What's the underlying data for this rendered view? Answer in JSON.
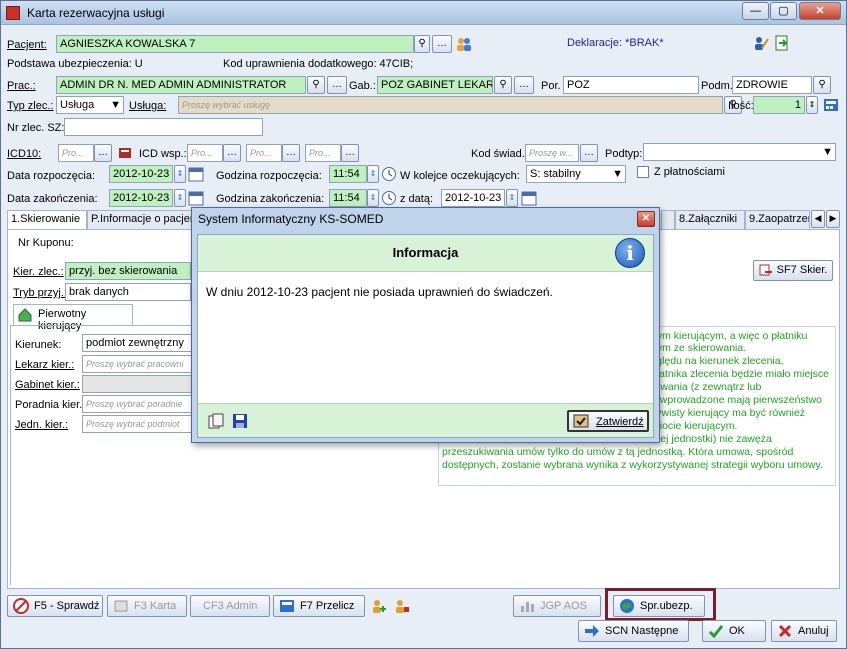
{
  "window": {
    "title": "Karta rezerwacyjna usługi"
  },
  "patient": {
    "label": "Pacjent:",
    "value": "AGNIESZKA KOWALSKA 7",
    "declarations": "Deklaracje: *BRAK*",
    "insurance": "Podstawa ubezpieczenia: U",
    "extra_code": "Kod uprawnienia dodatkowego: 47CIB;"
  },
  "staff": {
    "label": "Prac.:",
    "value": "ADMIN DR N. MED ADMIN ADMINISTRATOR",
    "gab_label": "Gab.:",
    "gab_value": "POZ GABINET LEKARZ",
    "por_label": "Por.",
    "por_value": "POZ",
    "podm_label": "Podm.",
    "podm_value": "ZDROWIE"
  },
  "order": {
    "type_label": "Typ zlec.:",
    "type_value": "Usługa",
    "service_label": "Usługa:",
    "service_placeholder": "Proszę wybrać usługę",
    "qty_label": "Ilość:",
    "qty_value": "1",
    "num_label": "Nr zlec. SZ:"
  },
  "icd": {
    "icd10_label": "ICD10:",
    "icd_wsp_label": "ICD wsp.:",
    "ph1": "Pro...",
    "ph2": "Pro...",
    "ph3": "Pro...",
    "ph4": "Pro...",
    "kod_label": "Kod świad.",
    "kod_placeholder": "Proszę w...",
    "podtyp_label": "Podtyp:"
  },
  "dates": {
    "start_label": "Data rozpoczęcia:",
    "start_value": "2012-10-23",
    "start_time_label": "Godzina rozpoczęcia:",
    "start_time_value": "11:54",
    "queue_label": "W kolejce oczekujących:",
    "queue_value": "S: stabilny",
    "with_payments": "Z płatnościami",
    "end_label": "Data zakończenia:",
    "end_value": "2012-10-23",
    "end_time_label": "Godzina zakończenia:",
    "end_time_value": "11:54",
    "from_date_label": "z datą:",
    "from_date_value": "2012-10-23"
  },
  "tabs": [
    "1.Skierowanie",
    "P.Informacje o pacjencie",
    "8.Załączniki",
    "9.Zaopatrzen"
  ],
  "referral": {
    "coupon_label": "Nr Kuponu:",
    "kier_label": "Kier. zlec.:",
    "kier_value": "przyj. bez skierowania",
    "tryb_label": "Tryb przyj.:",
    "tryb_value": "brak danych",
    "sf7_button": "SF7 Skier.",
    "subtab": "Pierwotny kierujący",
    "kierunek_label": "Kierunek:",
    "kierunek_value": "podmiot zewnętrzny",
    "lekarz_label": "Lekarz kier.:",
    "lekarz_placeholder": "Proszę wybrać pracowni",
    "gabinet_label": "Gabinet kier.:",
    "poradnia_label": "Poradnia kier.:",
    "poradnia_placeholder": "Proszę wybrać poradnie",
    "jedn_label": "Jedn. kier.:",
    "jedn_placeholder": "Proszę wybrać podmiot"
  },
  "help_text": {
    "line1": "nym kierującym, a więc o płatniku",
    "line2": "nym ze skierowania.",
    "line3": "zględu na kierunek zlecenia,",
    "line4": "płatnika zlecenia będzie miało miejsce",
    "line5": "rowania (z zewnątrz lub",
    "line6": "u wprowadzone mają pierwszeństwo",
    "line7": "zywisty kierujący ma być również",
    "line8": "miocie kierującym.",
    "line9": "rnej jednostki) nie zawęża",
    "line10": "przeszukiwania umów tylko do umów z tą jednostką. Która umowa, spośród",
    "line11": "dostępnych, zostanie wybrana wynika z wykorzystywanej strategii wyboru umowy."
  },
  "bottom": {
    "f5": "F5 - Sprawdź",
    "f3": "F3 Karta",
    "cf3": "CF3 Admin",
    "f7": "F7 Przelicz",
    "jgp": "JGP AOS",
    "spr": "Spr.ubezp.",
    "scn": "SCN Następne",
    "ok": "OK",
    "cancel": "Anuluj"
  },
  "dialog": {
    "title": "System Informatyczny KS-SOMED",
    "heading": "Informacja",
    "message": "W dniu 2012-10-23 pacjent nie posiada uprawnień do świadczeń.",
    "confirm": "Zatwierdź"
  },
  "colors": {
    "highlight_box": "#7a1f2b",
    "help_green": "#21a321"
  }
}
